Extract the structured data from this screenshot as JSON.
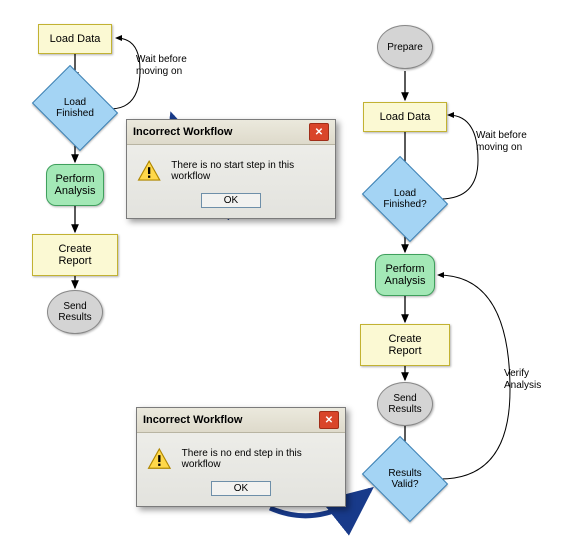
{
  "left_flow": {
    "load_data": "Load Data",
    "load_finished": "Load\nFinished",
    "perform_analysis": "Perform\nAnalysis",
    "create_report": "Create Report",
    "send_results": "Send\nResults",
    "loop_label": "Wait before\nmoving on"
  },
  "right_flow": {
    "prepare": "Prepare",
    "load_data": "Load Data",
    "load_finished": "Load\nFinished?",
    "perform_analysis": "Perform\nAnalysis",
    "create_report": "Create Report",
    "send_results": "Send\nResults",
    "results_valid": "Results\nValid?",
    "wait_label": "Wait before\nmoving on",
    "verify_label": "Verify\nAnalysis"
  },
  "dialog_top": {
    "title": "Incorrect Workflow",
    "message": "There is no start step in this workflow",
    "ok": "OK"
  },
  "dialog_bottom": {
    "title": "Incorrect Workflow",
    "message": "There is no end step in this workflow",
    "ok": "OK"
  }
}
